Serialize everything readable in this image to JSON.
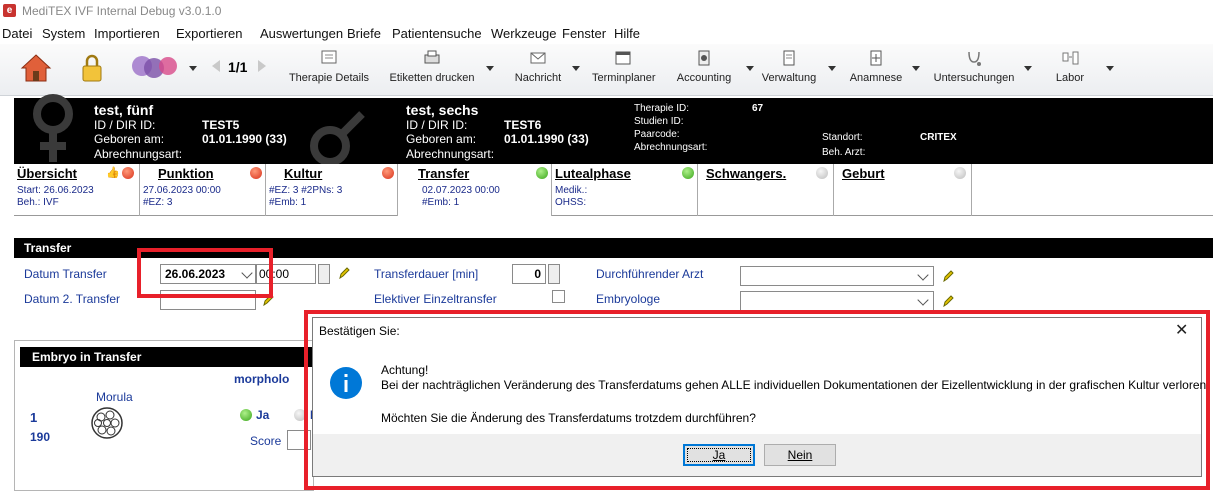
{
  "window": {
    "title": "MediTEX IVF Internal Debug v3.0.1.0"
  },
  "menu": [
    "Datei",
    "System",
    "Importieren",
    "Exportieren",
    "Auswertungen",
    "Briefe",
    "Patientensuche",
    "Werkzeuge",
    "Fenster",
    "Hilfe"
  ],
  "toolbar": {
    "pager": "1/1",
    "buttons": [
      {
        "label": "Therapie Details",
        "icon": "therapy-details-icon"
      },
      {
        "label": "Etiketten drucken",
        "icon": "print-labels-icon"
      },
      {
        "label": "Nachricht",
        "icon": "message-icon"
      },
      {
        "label": "Terminplaner",
        "icon": "scheduler-icon"
      },
      {
        "label": "Accounting",
        "icon": "accounting-icon"
      },
      {
        "label": "Verwaltung",
        "icon": "administration-icon"
      },
      {
        "label": "Anamnese",
        "icon": "anamnesis-icon"
      },
      {
        "label": "Untersuchungen",
        "icon": "examinations-icon"
      },
      {
        "label": "Labor",
        "icon": "lab-icon"
      }
    ]
  },
  "patient": {
    "female": {
      "name": "test, fünf",
      "id_label": "ID / DIR ID:",
      "id": "TEST5",
      "born_label": "Geboren am:",
      "born": "01.01.1990 (33)",
      "billing_label": "Abrechnungsart:"
    },
    "male": {
      "name": "test, sechs",
      "id_label": "ID / DIR ID:",
      "id": "TEST6",
      "born_label": "Geboren am:",
      "born": "01.01.1990 (33)",
      "billing_label": "Abrechnungsart:"
    },
    "therapy_id_label": "Therapie ID:",
    "therapy_id": "67",
    "study_id_label": "Studien ID:",
    "pair_code_label": "Paarcode:",
    "billing_label": "Abrechnungsart:",
    "location_label": "Standort:",
    "location": "CRITEX",
    "doctor_label": "Beh. Arzt:"
  },
  "tabs": [
    {
      "title": "Übersicht",
      "l1": "Start: 26.06.2023",
      "l2": "Beh.: IVF",
      "status": "red"
    },
    {
      "title": "Punktion",
      "l1": "27.06.2023 00:00",
      "l2": "#EZ: 3",
      "status": "red"
    },
    {
      "title": "Kultur",
      "l1": "#EZ: 3 #2PNs: 3",
      "l2": "#Emb: 1",
      "status": "red"
    },
    {
      "title": "Transfer",
      "l1": "02.07.2023 00:00",
      "l2": "#Emb: 1",
      "status": "green"
    },
    {
      "title": "Lutealphase",
      "l1": "Medik.:",
      "l2": "OHSS:",
      "status": "green"
    },
    {
      "title": "Schwangers.",
      "l1": "",
      "l2": "",
      "status": "grey"
    },
    {
      "title": "Geburt",
      "l1": "",
      "l2": "",
      "status": "grey"
    }
  ],
  "transfer": {
    "section_title": "Transfer",
    "date_label": "Datum Transfer",
    "date_value": "26.06.2023",
    "time_value": "00:00",
    "date2_label": "Datum 2. Transfer",
    "duration_label": "Transferdauer [min]",
    "duration_value": "0",
    "elective_label": "Elektiver Einzeltransfer",
    "doctor_label": "Durchführender Arzt",
    "embryologist_label": "Embryologe"
  },
  "embryo": {
    "section_title": "Embryo in Transfer",
    "morph_label": "morpholo",
    "stage": "Morula",
    "number": "1",
    "id": "190",
    "yes_label": "Ja",
    "no_label": "N",
    "score_label": "Score"
  },
  "dialog": {
    "title": "Bestätigen Sie:",
    "heading": "Achtung!",
    "message": "Bei der nachträglichen Veränderung des Transferdatums gehen ALLE individuellen Dokumentationen der Eizellentwicklung in der grafischen Kultur verloren.",
    "question": "Möchten Sie die Änderung des Transferdatums trotzdem durchführen?",
    "yes_button": "Ja",
    "no_button": "Nein",
    "close": "✕"
  },
  "colors": {
    "annotation_red": "#e8202a",
    "header_black": "#000000",
    "label_blue": "#1b3a9a",
    "info_blue": "#0078d7"
  }
}
